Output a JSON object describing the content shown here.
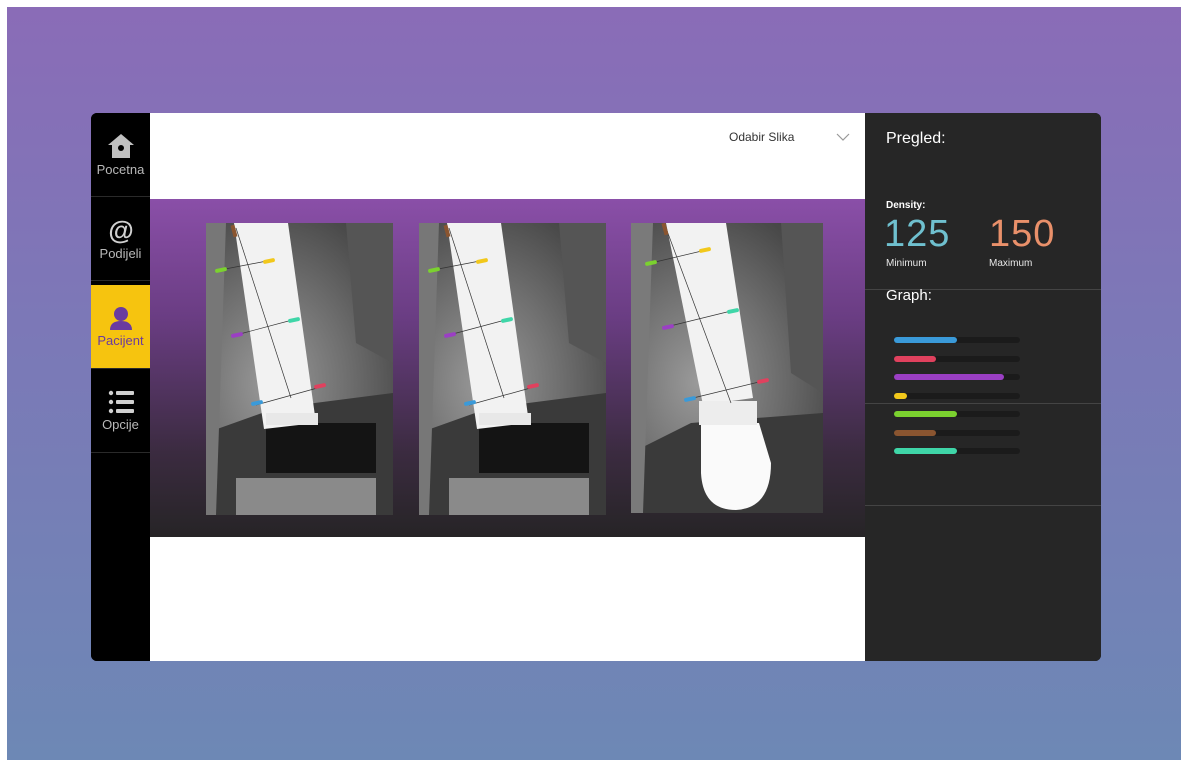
{
  "sidebar": {
    "items": [
      {
        "label": "Pocetna",
        "icon": "home-icon"
      },
      {
        "label": "Podijeli",
        "icon": "at-icon"
      },
      {
        "label": "Pacijent",
        "icon": "user-icon",
        "active": true
      },
      {
        "label": "Opcije",
        "icon": "list-icon"
      }
    ]
  },
  "header": {
    "dropdown_label": "Odabir Slika",
    "dropdown_icon": "chevron-down-icon"
  },
  "gallery": {
    "images": [
      {
        "kind": "dental x-ray of implant with measurement lines"
      },
      {
        "kind": "dental x-ray of implant with measurement lines"
      },
      {
        "kind": "dental x-ray of implant with crown and measurement lines"
      }
    ]
  },
  "panel": {
    "title": "Pregled:",
    "density_label": "Density:",
    "min_value": "125",
    "max_value": "150",
    "min_label": "Minimum",
    "max_label": "Maximum",
    "graph_title": "Graph:",
    "colors": {
      "min": "#6fc0cf",
      "max": "#e9906a"
    }
  },
  "chart_data": {
    "type": "bar",
    "series": [
      {
        "color": "#3a9ad9",
        "value": 0.5
      },
      {
        "color": "#e0415e",
        "value": 0.33
      },
      {
        "color": "#9b3fc4",
        "value": 0.87
      },
      {
        "color": "#f2c81b",
        "value": 0.1
      },
      {
        "color": "#7bd12f",
        "value": 0.5
      },
      {
        "color": "#8a5530",
        "value": 0.33
      },
      {
        "color": "#3fd6a8",
        "value": 0.5
      }
    ],
    "xlim": [
      0,
      1
    ]
  }
}
